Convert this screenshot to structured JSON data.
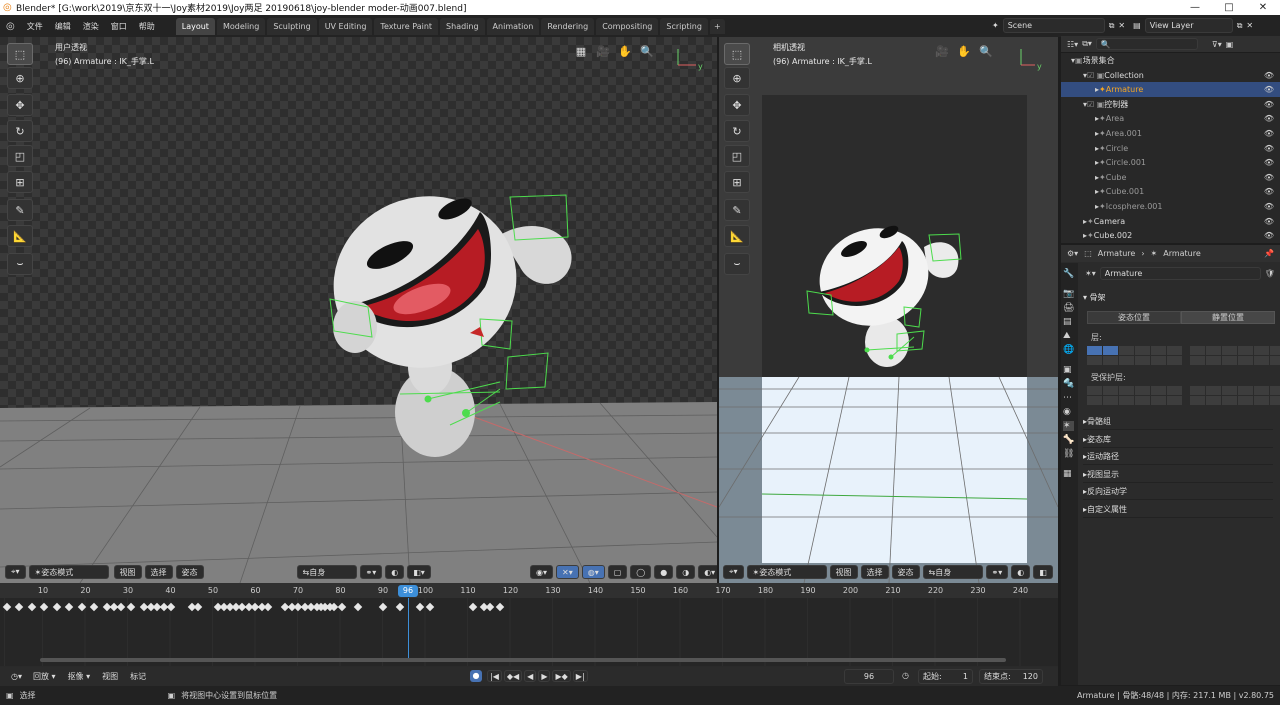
{
  "window": {
    "title": "Blender* [G:\\work\\2019\\京东双十一\\Joy素材2019\\Joy两足 20190618\\joy-blender moder-动画007.blend]",
    "controls": [
      "—",
      "□",
      "✕"
    ]
  },
  "menu": [
    "文件",
    "编辑",
    "渲染",
    "窗口",
    "帮助"
  ],
  "workspaces": [
    "Layout",
    "Modeling",
    "Sculpting",
    "UV Editing",
    "Texture Paint",
    "Shading",
    "Animation",
    "Rendering",
    "Compositing",
    "Scripting"
  ],
  "active_workspace": "Layout",
  "scene": {
    "label": "Scene",
    "view_layer": "View Layer"
  },
  "viewport_left": {
    "title": "用户透视",
    "subtitle": "(96) Armature : IK_手掌.L",
    "mode": "姿态模式",
    "menus": [
      "视图",
      "选择",
      "姿态"
    ],
    "orientation": "自身"
  },
  "viewport_right": {
    "title": "相机透视",
    "subtitle": "(96) Armature : IK_手掌.L",
    "mode": "姿态模式",
    "menus": [
      "视图",
      "选择",
      "姿态"
    ],
    "orientation": "自身"
  },
  "timeline": {
    "ticks": [
      "10",
      "20",
      "30",
      "40",
      "50",
      "60",
      "70",
      "80",
      "90",
      "100",
      "110",
      "120",
      "130",
      "140",
      "150",
      "160",
      "170",
      "180",
      "190",
      "200",
      "210",
      "220",
      "230",
      "240"
    ],
    "current_frame": "96",
    "menus": [
      "回放",
      "抠像",
      "视图",
      "标记"
    ],
    "frame_field": "96",
    "start_label": "起始:",
    "start": "1",
    "end_label": "结束点:",
    "end": "120"
  },
  "outliner": {
    "search_placeholder": "",
    "items": [
      {
        "label": "场景集合",
        "level": 0
      },
      {
        "label": "Collection",
        "level": 1
      },
      {
        "label": "Armature",
        "level": 2,
        "active": true
      },
      {
        "label": "控制器",
        "level": 1
      },
      {
        "label": "Area",
        "level": 2
      },
      {
        "label": "Area.001",
        "level": 2
      },
      {
        "label": "Circle",
        "level": 2
      },
      {
        "label": "Circle.001",
        "level": 2
      },
      {
        "label": "Cube",
        "level": 2
      },
      {
        "label": "Cube.001",
        "level": 2
      },
      {
        "label": "Icosphere.001",
        "level": 2
      },
      {
        "label": "Camera",
        "level": 1
      },
      {
        "label": "Cube.002",
        "level": 1
      }
    ]
  },
  "properties": {
    "breadcrumb": [
      "Armature",
      "Armature"
    ],
    "datablock": "Armature",
    "skeleton_section": "骨架",
    "pose_position": "姿态位置",
    "rest_position": "静置位置",
    "layers_label": "层:",
    "protected_label": "受保护层:",
    "sections": [
      "骨骼组",
      "姿态库",
      "运动路径",
      "视图显示",
      "反向运动学",
      "自定义属性"
    ]
  },
  "status": {
    "left_action": "选择",
    "hint": "将视图中心设置到鼠标位置",
    "info": "Armature | 骨骼:48/48 | 内存: 217.1 MB | v2.80.75"
  },
  "colors": {
    "accent": "#4772b3",
    "active_item": "#f5a623",
    "keyframe": "#e6e6e6",
    "playhead": "#3d8fd9"
  }
}
